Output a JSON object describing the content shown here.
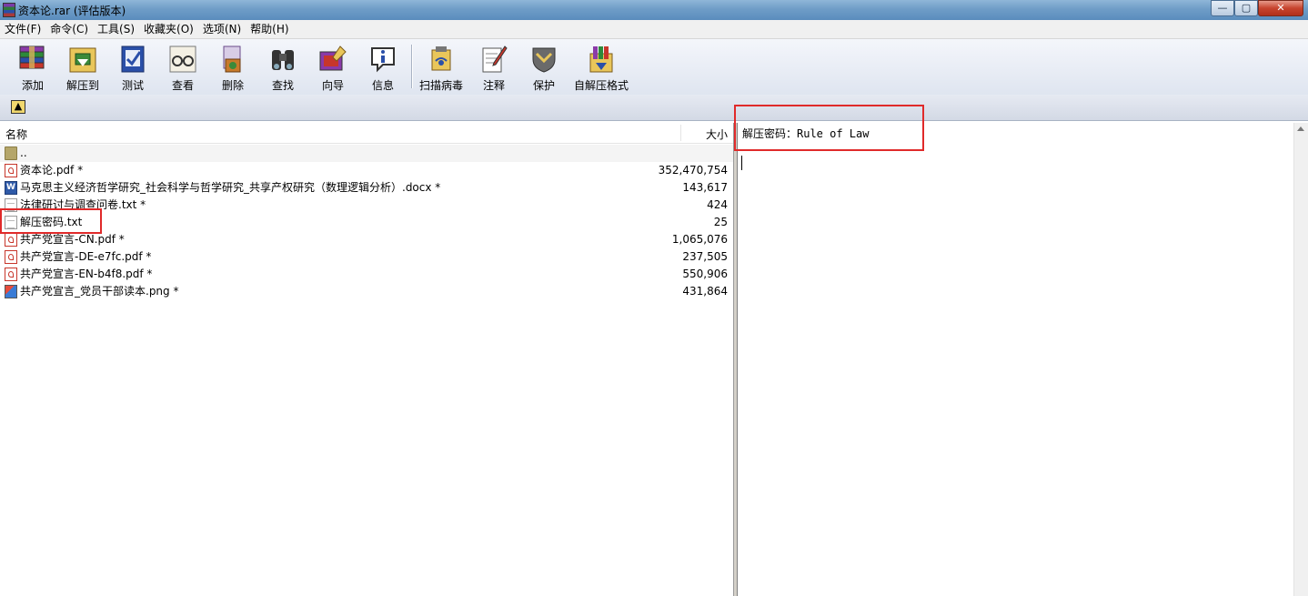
{
  "window": {
    "title": "资本论.rar (评估版本)",
    "minimize": "—",
    "maximize": "▢",
    "close": "✕"
  },
  "menu": [
    "文件(F)",
    "命令(C)",
    "工具(S)",
    "收藏夹(O)",
    "选项(N)",
    "帮助(H)"
  ],
  "toolbar": {
    "add": "添加",
    "extract_to": "解压到",
    "test": "测试",
    "view": "查看",
    "delete": "删除",
    "find": "查找",
    "wizard": "向导",
    "info": "信息",
    "virus_scan": "扫描病毒",
    "comment": "注释",
    "protect": "保护",
    "sfx": "自解压格式"
  },
  "list": {
    "header_name": "名称",
    "header_size": "大小",
    "parent": "..",
    "files": [
      {
        "name": "资本论.pdf *",
        "size": "352,470,754",
        "icon": "pdf-icon"
      },
      {
        "name": "马克思主义经济哲学研究_社会科学与哲学研究_共享产权研究（数理逻辑分析）.docx *",
        "size": "143,617",
        "icon": "word-doc-icon"
      },
      {
        "name": "法律研讨与调查问卷.txt *",
        "size": "424",
        "icon": "text-file-icon"
      },
      {
        "name": "解压密码.txt",
        "size": "25",
        "icon": "text-file-icon"
      },
      {
        "name": "共产党宣言-CN.pdf *",
        "size": "1,065,076",
        "icon": "pdf-icon"
      },
      {
        "name": "共产党宣言-DE-e7fc.pdf *",
        "size": "237,505",
        "icon": "pdf-icon"
      },
      {
        "name": "共产党宣言-EN-b4f8.pdf *",
        "size": "550,906",
        "icon": "pdf-icon"
      },
      {
        "name": "共产党宣言_党员干部读本.png *",
        "size": "431,864",
        "icon": "image-file-icon"
      }
    ]
  },
  "preview": {
    "text": "解压密码：Rule of Law"
  },
  "colors": {
    "highlight": "#e02a2a",
    "titlebar": "#6f9dc7"
  }
}
